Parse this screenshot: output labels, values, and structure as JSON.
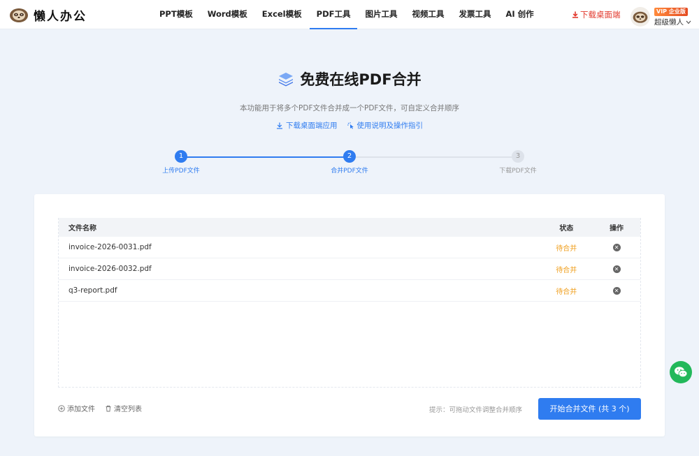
{
  "header": {
    "logo_text": "懒人办公",
    "nav": [
      {
        "label": "PPT模板",
        "active": false
      },
      {
        "label": "Word模板",
        "active": false
      },
      {
        "label": "Excel模板",
        "active": false
      },
      {
        "label": "PDF工具",
        "active": true
      },
      {
        "label": "图片工具",
        "active": false
      },
      {
        "label": "视频工具",
        "active": false
      },
      {
        "label": "发票工具",
        "active": false
      },
      {
        "label": "AI 创作",
        "active": false
      }
    ],
    "download_label": "下载桌面端",
    "vip_badge": "VIP 企业版",
    "user_name": "超级懒人"
  },
  "page": {
    "title": "免费在线PDF合并",
    "subtitle": "本功能用于将多个PDF文件合并成一个PDF文件，可自定义合并顺序",
    "link_download": "下载桌面端应用",
    "link_guide": "使用说明及操作指引"
  },
  "steps": [
    {
      "number": "1",
      "label": "上传PDF文件",
      "state": "done"
    },
    {
      "number": "2",
      "label": "合并PDF文件",
      "state": "current"
    },
    {
      "number": "3",
      "label": "下载PDF文件",
      "state": "pending"
    }
  ],
  "table": {
    "headers": {
      "name": "文件名称",
      "status": "状态",
      "action": "操作"
    },
    "rows": [
      {
        "name": "invoice-2026-0031.pdf",
        "status": "待合并"
      },
      {
        "name": "invoice-2026-0032.pdf",
        "status": "待合并"
      },
      {
        "name": "q3-report.pdf",
        "status": "待合并"
      }
    ]
  },
  "footer": {
    "add_file": "添加文件",
    "clear_list": "清空列表",
    "hint": "提示：可拖动文件调整合并顺序",
    "merge_button": "开始合并文件 (共 3 个)"
  },
  "colors": {
    "primary": "#2f7cf0",
    "download_red": "#e23a2e",
    "pending_orange": "#f0a020",
    "wechat_green": "#22b85a"
  }
}
